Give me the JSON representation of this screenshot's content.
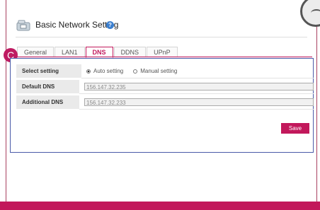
{
  "header": {
    "title": "Basic Network Setting",
    "help_icon": "question-icon"
  },
  "tabs": [
    {
      "label": "General",
      "active": false
    },
    {
      "label": "LAN1",
      "active": false
    },
    {
      "label": "DNS",
      "active": true
    },
    {
      "label": "DDNS",
      "active": false
    },
    {
      "label": "UPnP",
      "active": false
    }
  ],
  "callout": "C",
  "form": {
    "select_setting": {
      "label": "Select setting",
      "options": [
        "Auto setting",
        "Manual setting"
      ],
      "selected": "Auto setting"
    },
    "default_dns": {
      "label": "Default DNS",
      "value": "156.147.32.235"
    },
    "additional_dns": {
      "label": "Additional DNS",
      "value": "156.147.32.233"
    },
    "save_label": "Save"
  },
  "colors": {
    "accent": "#c2185b",
    "panel_border": "#4a5aa8"
  }
}
